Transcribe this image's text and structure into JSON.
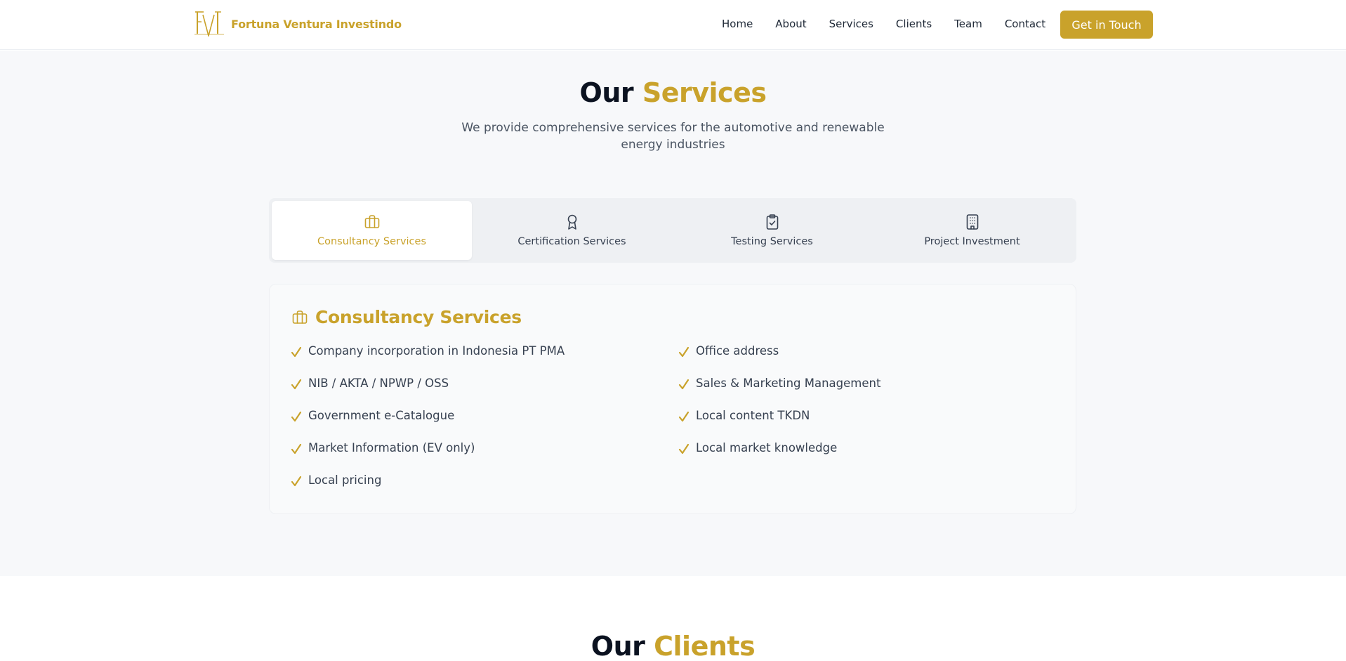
{
  "brand": {
    "name": "Fortuna Ventura Investindo",
    "logo_icon": "fvi-monogram-logo"
  },
  "nav": {
    "links": [
      "Home",
      "About",
      "Services",
      "Clients",
      "Team",
      "Contact"
    ],
    "cta": "Get in Touch"
  },
  "services": {
    "title_main": "Our",
    "title_accent": "Services",
    "subtitle": "We provide comprehensive services for the automotive and renewable energy industries",
    "tabs": [
      {
        "label": "Consultancy Services",
        "icon": "briefcase-icon",
        "active": true
      },
      {
        "label": "Certification Services",
        "icon": "award-icon",
        "active": false
      },
      {
        "label": "Testing Services",
        "icon": "clipboard-check-icon",
        "active": false
      },
      {
        "label": "Project Investment",
        "icon": "building-icon",
        "active": false
      }
    ],
    "panel": {
      "title": "Consultancy Services",
      "icon": "briefcase-icon",
      "features_left": [
        "Company incorporation in Indonesia PT PMA",
        "NIB / AKTA / NPWP / OSS",
        "Government e-Catalogue",
        "Market Information (EV only)",
        "Local pricing"
      ],
      "features_right": [
        "Office address",
        "Sales & Marketing Management",
        "Local content TKDN",
        "Local market knowledge"
      ]
    }
  },
  "clients": {
    "title_main": "Our",
    "title_accent": "Clients"
  },
  "colors": {
    "accent": "#c9a22b",
    "dark": "#0b1220",
    "section_bg": "#f7f8fa"
  }
}
